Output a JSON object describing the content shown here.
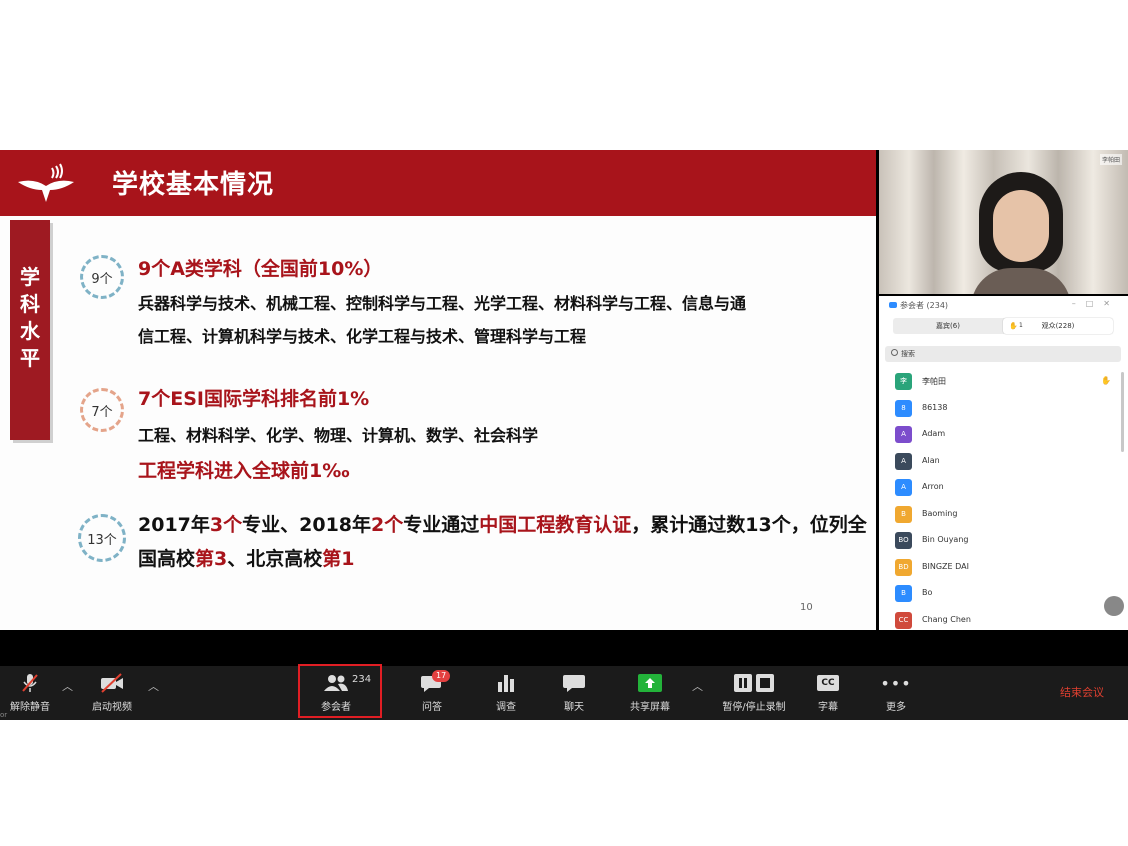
{
  "slide": {
    "title": "学校基本情况",
    "vertical_tab": "学科水平",
    "sec1": {
      "badge": "9个",
      "title": "9个A类学科（全国前10%）",
      "line1": "兵器科学与技术、机械工程、控制科学与工程、光学工程、材料科学与工程、信息与通",
      "line2": "信工程、计算机科学与技术、化学工程与技术、管理科学与工程"
    },
    "sec2": {
      "badge": "7个",
      "title": "7个ESI国际学科排名前1%",
      "line1": "工程、材料科学、化学、物理、计算机、数学、社会科学",
      "line2": "工程学科进入全球前1‰"
    },
    "sec3": {
      "badge": "13个",
      "p1": "2017年",
      "p2": "3个",
      "p3": "专业、2018年",
      "p4": "2个",
      "p5": "专业通过",
      "p6": "中国工程教育认证",
      "p7": "，累计通过数13个，位列全国高校",
      "p8": "第3",
      "p9": "、北京高校",
      "p10": "第1"
    },
    "page_number": "10"
  },
  "video": {
    "label": "李帕田"
  },
  "participants": {
    "title": "参会者 (234)",
    "tab_panelists": "嘉宾(6)",
    "tab_attendees": "观众(228)",
    "raised_count": "1",
    "search_placeholder": "搜索",
    "list": [
      {
        "initial": "李",
        "name": "李帕田",
        "color": "#2aa47a",
        "hand": "✋"
      },
      {
        "initial": "8",
        "name": "86138",
        "color": "#2d8cff",
        "hand": ""
      },
      {
        "initial": "A",
        "name": "Adam",
        "color": "#7c4dcc",
        "hand": ""
      },
      {
        "initial": "A",
        "name": "Alan",
        "color": "#3b4a5c",
        "hand": ""
      },
      {
        "initial": "A",
        "name": "Arron",
        "color": "#2d8cff",
        "hand": ""
      },
      {
        "initial": "B",
        "name": "Baoming",
        "color": "#f0a830",
        "hand": ""
      },
      {
        "initial": "BO",
        "name": "Bin Ouyang",
        "color": "#3b4a5c",
        "hand": ""
      },
      {
        "initial": "BD",
        "name": "BINGZE DAI",
        "color": "#f0a830",
        "hand": ""
      },
      {
        "initial": "B",
        "name": "Bo",
        "color": "#2d8cff",
        "hand": ""
      },
      {
        "initial": "CC",
        "name": "Chang Chen",
        "color": "#d04a3c",
        "hand": ""
      }
    ]
  },
  "toolbar": {
    "unmute": "解除静音",
    "start_video": "启动视频",
    "participants": "参会者",
    "participants_count": "234",
    "qa": "问答",
    "qa_badge": "17",
    "polls": "调查",
    "chat": "聊天",
    "share": "共享屏幕",
    "record": "暂停/停止录制",
    "cc": "字幕",
    "cc_icon": "CC",
    "more": "更多",
    "end": "结束会议",
    "footer_fragment": "or"
  },
  "colors": {
    "brand_red": "#a8141b",
    "toolbar_bg": "#1b1b1b",
    "highlight": "#e11e24",
    "share_green": "#23b33a",
    "accent_blue": "#2d8cff"
  }
}
